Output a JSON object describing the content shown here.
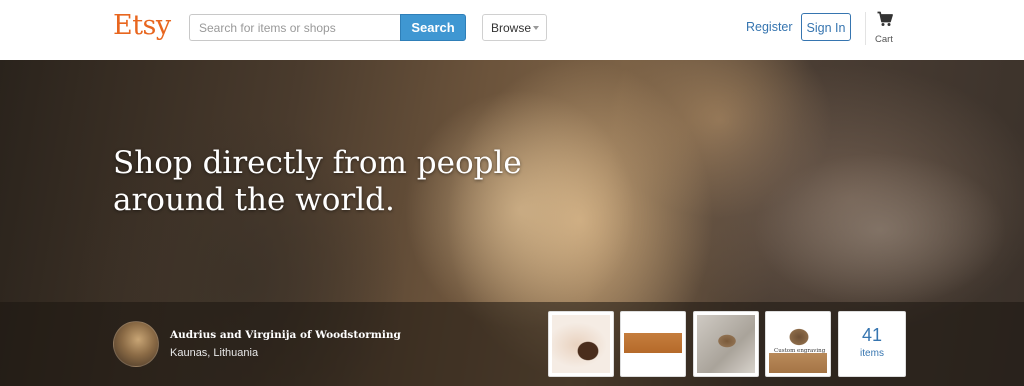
{
  "header": {
    "logo": "Etsy",
    "search": {
      "placeholder": "Search for items or shops",
      "value": "",
      "button_label": "Search"
    },
    "browse_label": "Browse",
    "register_label": "Register",
    "signin_label": "Sign In",
    "cart_label": "Cart",
    "colors": {
      "brand": "#e8661f",
      "search_button": "#3f97d2",
      "link": "#3675b0"
    }
  },
  "hero": {
    "title": "Shop directly from people around the world.",
    "seller": {
      "name": "Audrius and Virginija of Woodstorming",
      "location": "Kaunas, Lithuania"
    },
    "thumbnails": [
      {
        "icon": "product-photo-hands-wood-block"
      },
      {
        "icon": "product-photo-wooden-plank"
      },
      {
        "icon": "product-photo-wood-tool"
      },
      {
        "icon": "product-photo-engraved-box",
        "caption": "Custom engraving"
      }
    ],
    "items_count": "41",
    "items_label": "items"
  }
}
